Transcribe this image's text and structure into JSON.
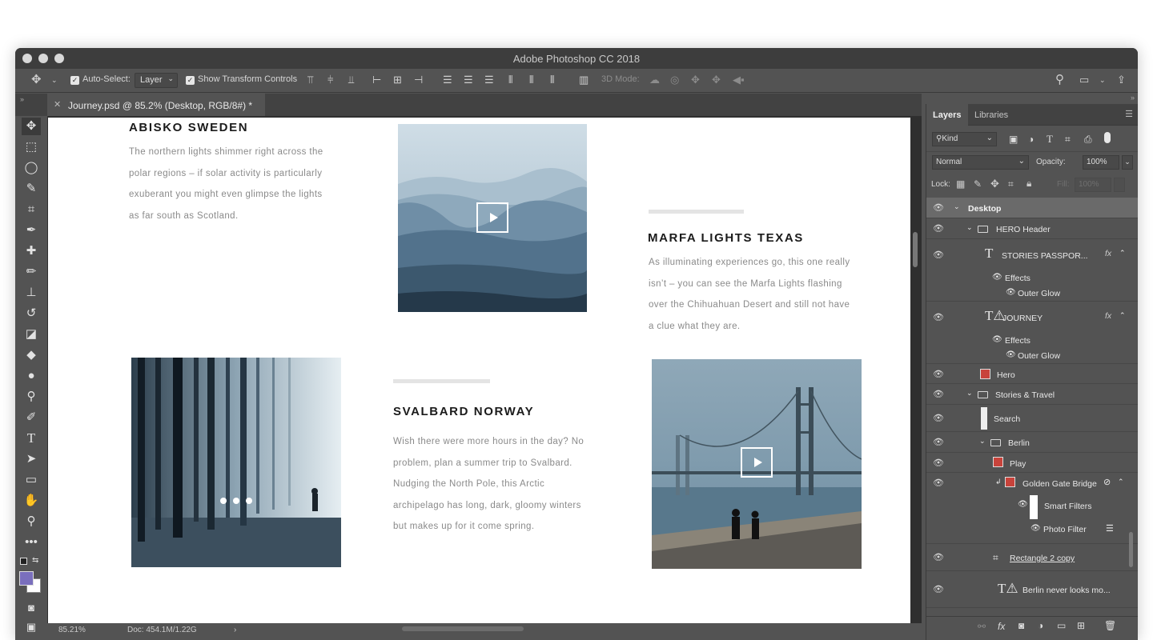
{
  "window": {
    "title": "Adobe Photoshop CC 2018"
  },
  "options_bar": {
    "auto_select_label": "Auto-Select:",
    "auto_select_value": "Layer",
    "show_transform_label": "Show Transform Controls",
    "mode_3d_label": "3D Mode:"
  },
  "document_tab": {
    "title": "Journey.psd @ 85.2% (Desktop, RGB/8#) *"
  },
  "status_bar": {
    "zoom": "85.21%",
    "doc": "Doc: 454.1M/1.22G"
  },
  "artboard": {
    "abisko": {
      "title": "ABISKO SWEDEN",
      "lines": [
        "The northern lights shimmer right across the",
        "polar regions – if solar activity is particularly",
        "exuberant you might even glimpse the lights",
        "as far south as Scotland."
      ]
    },
    "marfa": {
      "title": "MARFA LIGHTS TEXAS",
      "lines": [
        "As illuminating experiences go, this one really",
        "isn’t – you can see the Marfa Lights flashing",
        "over the Chihuahuan Desert and still not have",
        "a clue what they are."
      ]
    },
    "svalbard": {
      "title": "SVALBARD NORWAY",
      "lines": [
        "Wish there were more hours in the day? No",
        "problem, plan a summer trip to Svalbard.",
        "Nudging the North Pole, this Arctic",
        " archipelago has long, dark, gloomy winters",
        "but makes up for it come spring."
      ]
    }
  },
  "panel": {
    "tabs": [
      "Layers",
      "Libraries"
    ],
    "kind_filter": "Kind",
    "blend_mode": "Normal",
    "opacity_label": "Opacity:",
    "opacity_value": "100%",
    "lock_label": "Lock:",
    "fill_label": "Fill:",
    "fill_value": "100%",
    "layers": [
      {
        "name": "Desktop"
      },
      {
        "name": "HERO Header"
      },
      {
        "name": "STORIES     PASSPOR..."
      },
      {
        "name": "Effects"
      },
      {
        "name": "Outer Glow"
      },
      {
        "name": "JOURNEY"
      },
      {
        "name": "Effects"
      },
      {
        "name": "Outer Glow"
      },
      {
        "name": "Hero"
      },
      {
        "name": "Stories & Travel"
      },
      {
        "name": "Search"
      },
      {
        "name": "Berlin"
      },
      {
        "name": "Play"
      },
      {
        "name": "Golden Gate Bridge"
      },
      {
        "name": "Smart Filters"
      },
      {
        "name": "Photo Filter"
      },
      {
        "name": "Rectangle 2 copy"
      },
      {
        "name": "Berlin never looks mo..."
      }
    ],
    "fx_label": "fx"
  },
  "colors": {
    "foreground": "#7a6fbd",
    "background": "#ffffff",
    "selected_layer": "#6a6a6a"
  },
  "icons": [
    "move-icon",
    "marquee-icon",
    "lasso-icon",
    "quick-select-icon",
    "crop-icon",
    "eyedropper-icon",
    "healing-icon",
    "brush-icon",
    "stamp-icon",
    "history-brush-icon",
    "eraser-icon",
    "bucket-icon",
    "blur-icon",
    "dodge-icon",
    "pen-icon",
    "type-icon",
    "path-select-icon",
    "rectangle-icon",
    "hand-icon",
    "zoom-icon",
    "more-icon",
    "search-icon",
    "share-icon",
    "eye-icon"
  ]
}
